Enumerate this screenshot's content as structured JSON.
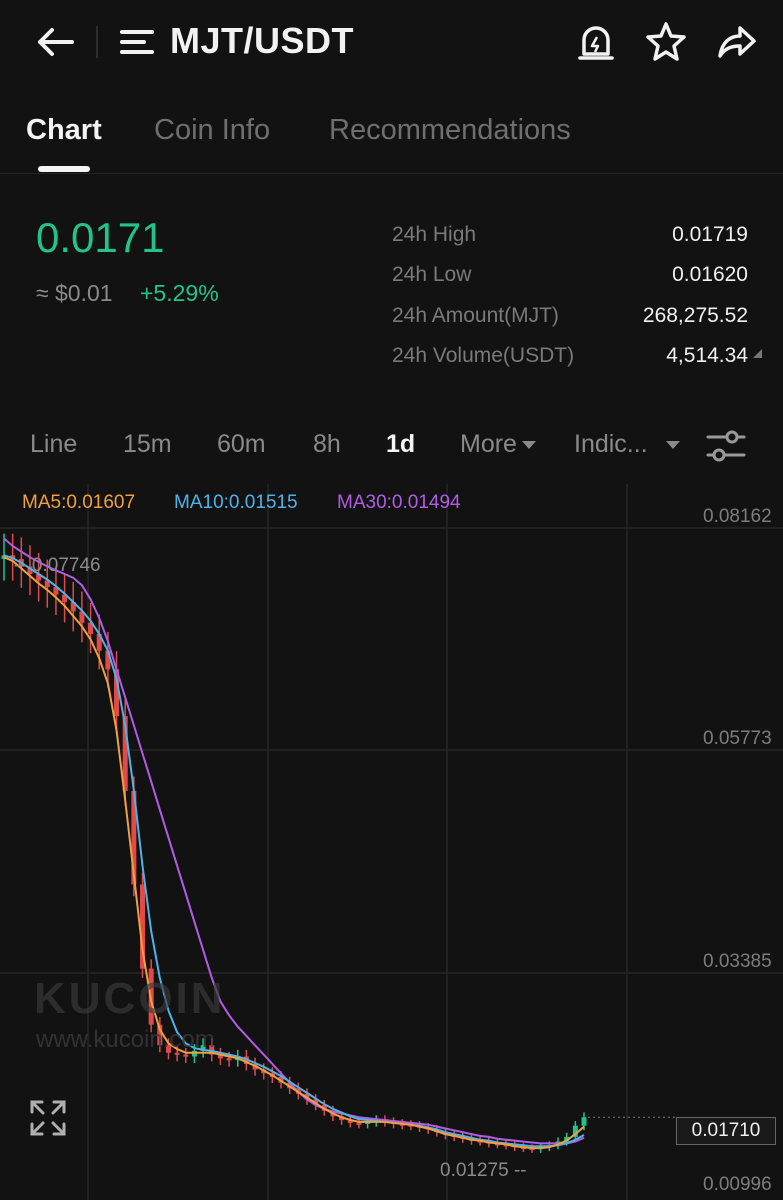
{
  "header": {
    "pair": "MJT/USDT"
  },
  "tabs": [
    {
      "label": "Chart",
      "active": true
    },
    {
      "label": "Coin Info",
      "active": false
    },
    {
      "label": "Recommendations",
      "active": false
    }
  ],
  "ticker": {
    "last_price": "0.0171",
    "fiat_value": "≈ $0.01",
    "change_pct": "+5.29%",
    "up_color": "#22c48a",
    "down_color": "#e24a4a"
  },
  "stats": [
    {
      "label": "24h High",
      "value": "0.01719"
    },
    {
      "label": "24h Low",
      "value": "0.01620"
    },
    {
      "label": "24h Amount(MJT)",
      "value": "268,275.52"
    },
    {
      "label": "24h Volume(USDT)",
      "value": "4,514.34"
    }
  ],
  "intervals": [
    {
      "label": "Line",
      "active": false
    },
    {
      "label": "15m",
      "active": false
    },
    {
      "label": "60m",
      "active": false
    },
    {
      "label": "8h",
      "active": false
    },
    {
      "label": "1d",
      "active": true
    },
    {
      "label": "More",
      "active": false,
      "dropdown": true
    },
    {
      "label": "Indic...",
      "active": false,
      "dropdown": true
    }
  ],
  "ma_legend": [
    {
      "label": "MA5:0.01607",
      "color": "#f0a040"
    },
    {
      "label": "MA10:0.01515",
      "color": "#4fb3e8"
    },
    {
      "label": "MA30:0.01494",
      "color": "#b25ce6"
    }
  ],
  "watermark": {
    "logo": "KUCOIN",
    "url": "www.kucoin.com"
  },
  "chart_data": {
    "type": "candlestick",
    "interval": "1d",
    "y_axis_labels": [
      "0.08162",
      "0.05773",
      "0.03385",
      "0.00996"
    ],
    "ylim": [
      0.00996,
      0.08162
    ],
    "last_price_tag": "0.01710",
    "high_marker": "0.07746",
    "low_marker": "0.01275",
    "grid": true,
    "close_series": [
      0.0772,
      0.0768,
      0.076,
      0.0752,
      0.0745,
      0.0738,
      0.073,
      0.0722,
      0.0712,
      0.07,
      0.0688,
      0.067,
      0.065,
      0.06,
      0.052,
      0.042,
      0.033,
      0.027,
      0.0248,
      0.024,
      0.0238,
      0.0236,
      0.0242,
      0.0248,
      0.0238,
      0.0234,
      0.0232,
      0.0236,
      0.0228,
      0.0222,
      0.0218,
      0.0214,
      0.0208,
      0.0202,
      0.0196,
      0.019,
      0.0184,
      0.0178,
      0.0172,
      0.0168,
      0.0165,
      0.0164,
      0.0166,
      0.0168,
      0.0166,
      0.0164,
      0.0163,
      0.0162,
      0.016,
      0.0158,
      0.0155,
      0.0152,
      0.015,
      0.0148,
      0.0146,
      0.0145,
      0.0143,
      0.0142,
      0.0141,
      0.0139,
      0.0138,
      0.0137,
      0.0139,
      0.0141,
      0.0145,
      0.015,
      0.0162,
      0.0171
    ],
    "ma5": [
      0.077,
      0.0766,
      0.0758,
      0.075,
      0.0742,
      0.0735,
      0.0727,
      0.0718,
      0.0707,
      0.0696,
      0.0682,
      0.0662,
      0.0635,
      0.0585,
      0.051,
      0.043,
      0.035,
      0.0295,
      0.0265,
      0.025,
      0.0244,
      0.024,
      0.024,
      0.024,
      0.024,
      0.0238,
      0.0236,
      0.0234,
      0.023,
      0.0226,
      0.0221,
      0.0216,
      0.021,
      0.0204,
      0.0198,
      0.0192,
      0.0186,
      0.018,
      0.0175,
      0.0171,
      0.0168,
      0.0166,
      0.0166,
      0.0166,
      0.0166,
      0.0165,
      0.0164,
      0.0163,
      0.0161,
      0.0159,
      0.0156,
      0.0153,
      0.0151,
      0.0149,
      0.0147,
      0.0146,
      0.0144,
      0.0143,
      0.0142,
      0.014,
      0.0139,
      0.0138,
      0.0138,
      0.0139,
      0.0142,
      0.0146,
      0.0153,
      0.0161
    ],
    "ma10": [
      0.0772,
      0.0769,
      0.0764,
      0.0758,
      0.0752,
      0.0746,
      0.0739,
      0.0731,
      0.0722,
      0.0713,
      0.0702,
      0.0688,
      0.067,
      0.064,
      0.059,
      0.052,
      0.044,
      0.037,
      0.032,
      0.0285,
      0.0262,
      0.025,
      0.0245,
      0.0243,
      0.0242,
      0.024,
      0.0238,
      0.0236,
      0.0233,
      0.0229,
      0.0225,
      0.022,
      0.0215,
      0.0209,
      0.0203,
      0.0197,
      0.0191,
      0.0185,
      0.018,
      0.0176,
      0.0172,
      0.0169,
      0.0168,
      0.0167,
      0.0166,
      0.0165,
      0.0164,
      0.0163,
      0.0162,
      0.016,
      0.0158,
      0.0155,
      0.0153,
      0.0151,
      0.0149,
      0.0147,
      0.0146,
      0.0144,
      0.0143,
      0.0142,
      0.0141,
      0.014,
      0.014,
      0.014,
      0.0141,
      0.0143,
      0.0147,
      0.0152
    ],
    "ma30": [
      0.079,
      0.0782,
      0.0776,
      0.077,
      0.0765,
      0.076,
      0.0756,
      0.0752,
      0.0748,
      0.074,
      0.0725,
      0.0705,
      0.068,
      0.065,
      0.062,
      0.059,
      0.056,
      0.053,
      0.05,
      0.047,
      0.044,
      0.041,
      0.038,
      0.035,
      0.032,
      0.0295,
      0.028,
      0.0268,
      0.0258,
      0.0248,
      0.0238,
      0.0228,
      0.0218,
      0.0208,
      0.0198,
      0.019,
      0.0184,
      0.018,
      0.0177,
      0.0175,
      0.0173,
      0.0171,
      0.017,
      0.0169,
      0.0168,
      0.0167,
      0.0166,
      0.0165,
      0.0164,
      0.0163,
      0.0161,
      0.0159,
      0.0157,
      0.0155,
      0.0153,
      0.0151,
      0.015,
      0.0148,
      0.0147,
      0.0146,
      0.0145,
      0.0144,
      0.0143,
      0.0143,
      0.0143,
      0.0143,
      0.0145,
      0.0149
    ]
  }
}
